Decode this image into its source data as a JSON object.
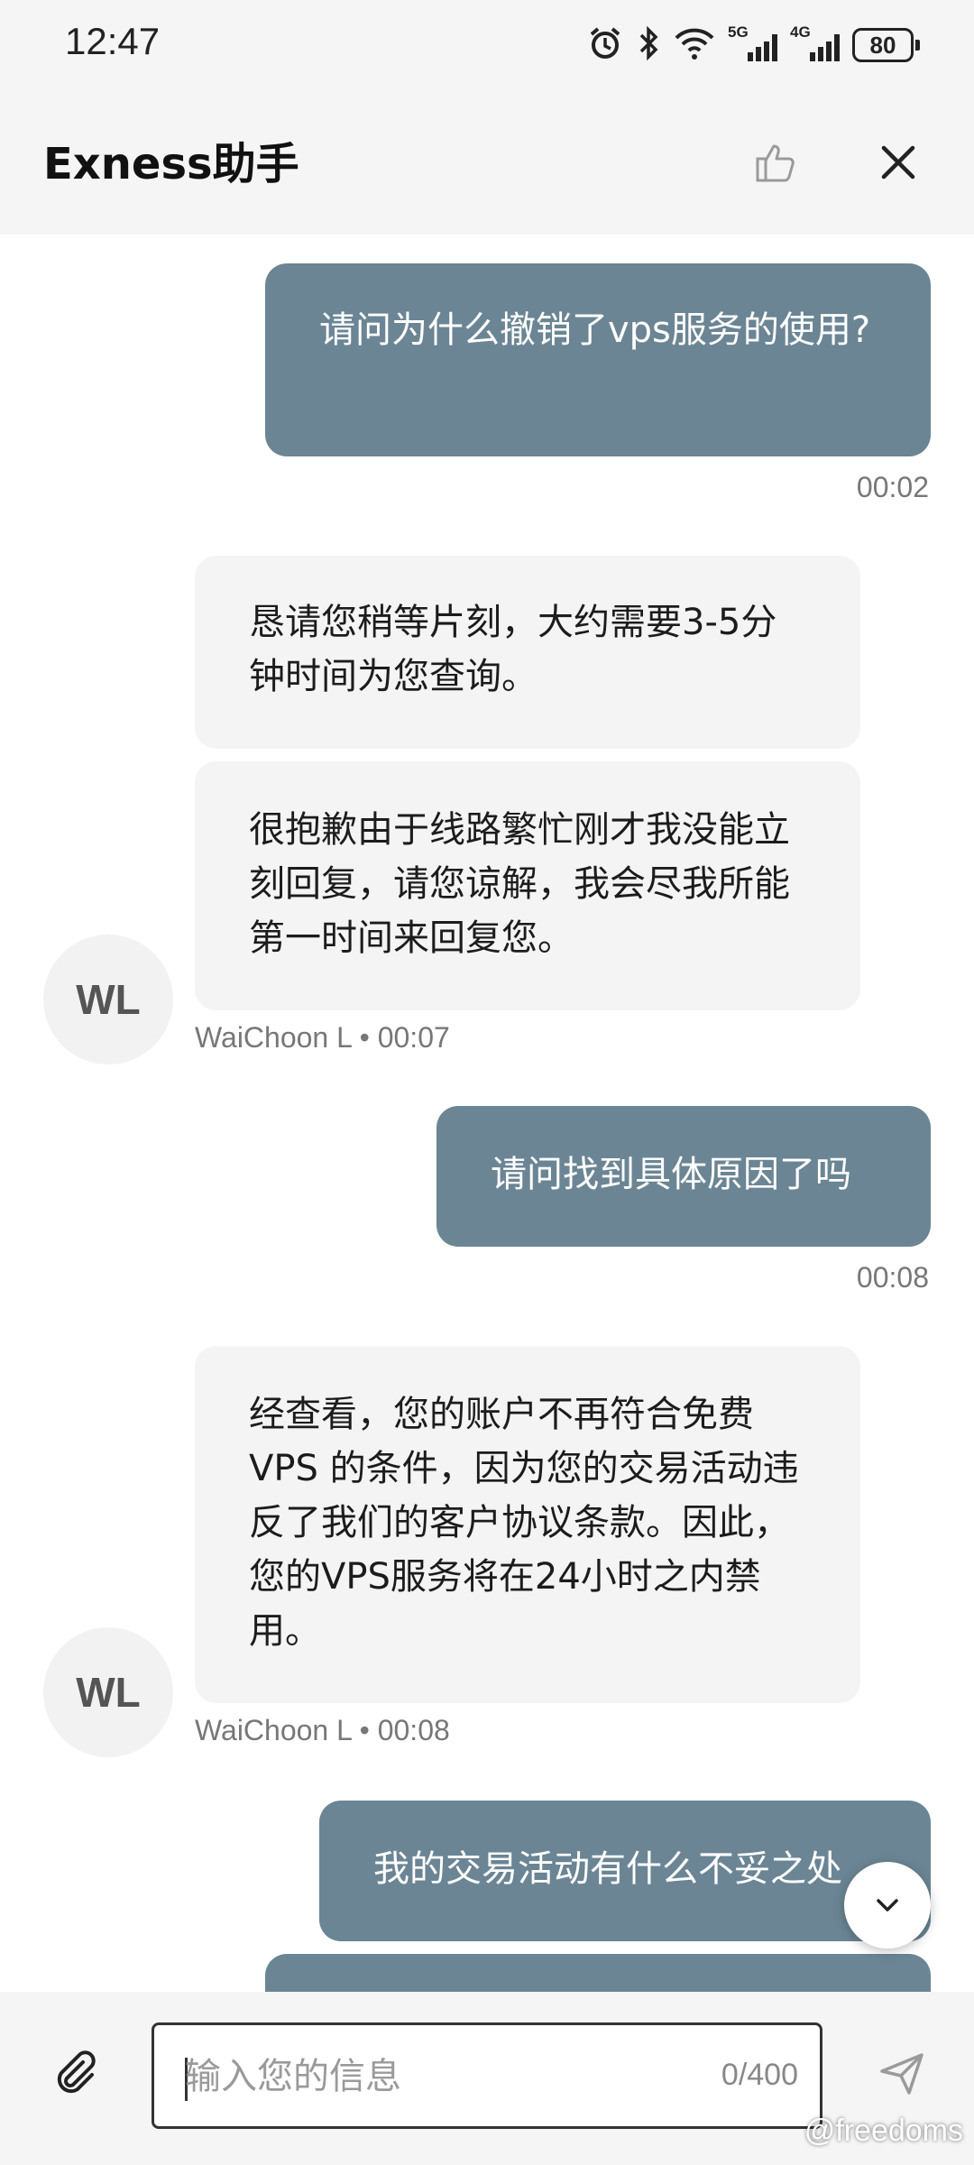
{
  "status_bar": {
    "time": "12:47",
    "signal_5g_label": "5G",
    "signal_4g_label": "4G",
    "battery": "80"
  },
  "header": {
    "title": "Exness助手"
  },
  "messages": [
    {
      "side": "out",
      "text": "请问为什么撤销了vps服务的使用?",
      "time": "00:02"
    },
    {
      "side": "in",
      "text": "恳请您稍等片刻，大约需要3-5分钟时间为您查询。"
    },
    {
      "side": "in",
      "text": "很抱歉由于线路繁忙刚才我没能立刻回复，请您谅解，我会尽我所能第一时间来回复您。",
      "meta": "WaiChoon L • 00:07",
      "avatar": "WL"
    },
    {
      "side": "out",
      "text": "请问找到具体原因了吗",
      "time": "00:08"
    },
    {
      "side": "in",
      "text": "经查看，您的账户不再符合免费VPS 的条件，因为您的交易活动违反了我们的客户协议条款。因此，您的VPS服务将在24小时之内禁用。",
      "meta": "WaiChoon L • 00:08",
      "avatar": "WL"
    },
    {
      "side": "out",
      "text": "我的交易活动有什么不妥之处"
    }
  ],
  "input": {
    "placeholder": "输入您的信息",
    "counter": "0/400"
  },
  "watermark": "@freedoms",
  "colors": {
    "outgoing_bubble": "#6b8594",
    "incoming_bubble": "#f4f4f4",
    "bar_background": "#f5f5f5"
  }
}
